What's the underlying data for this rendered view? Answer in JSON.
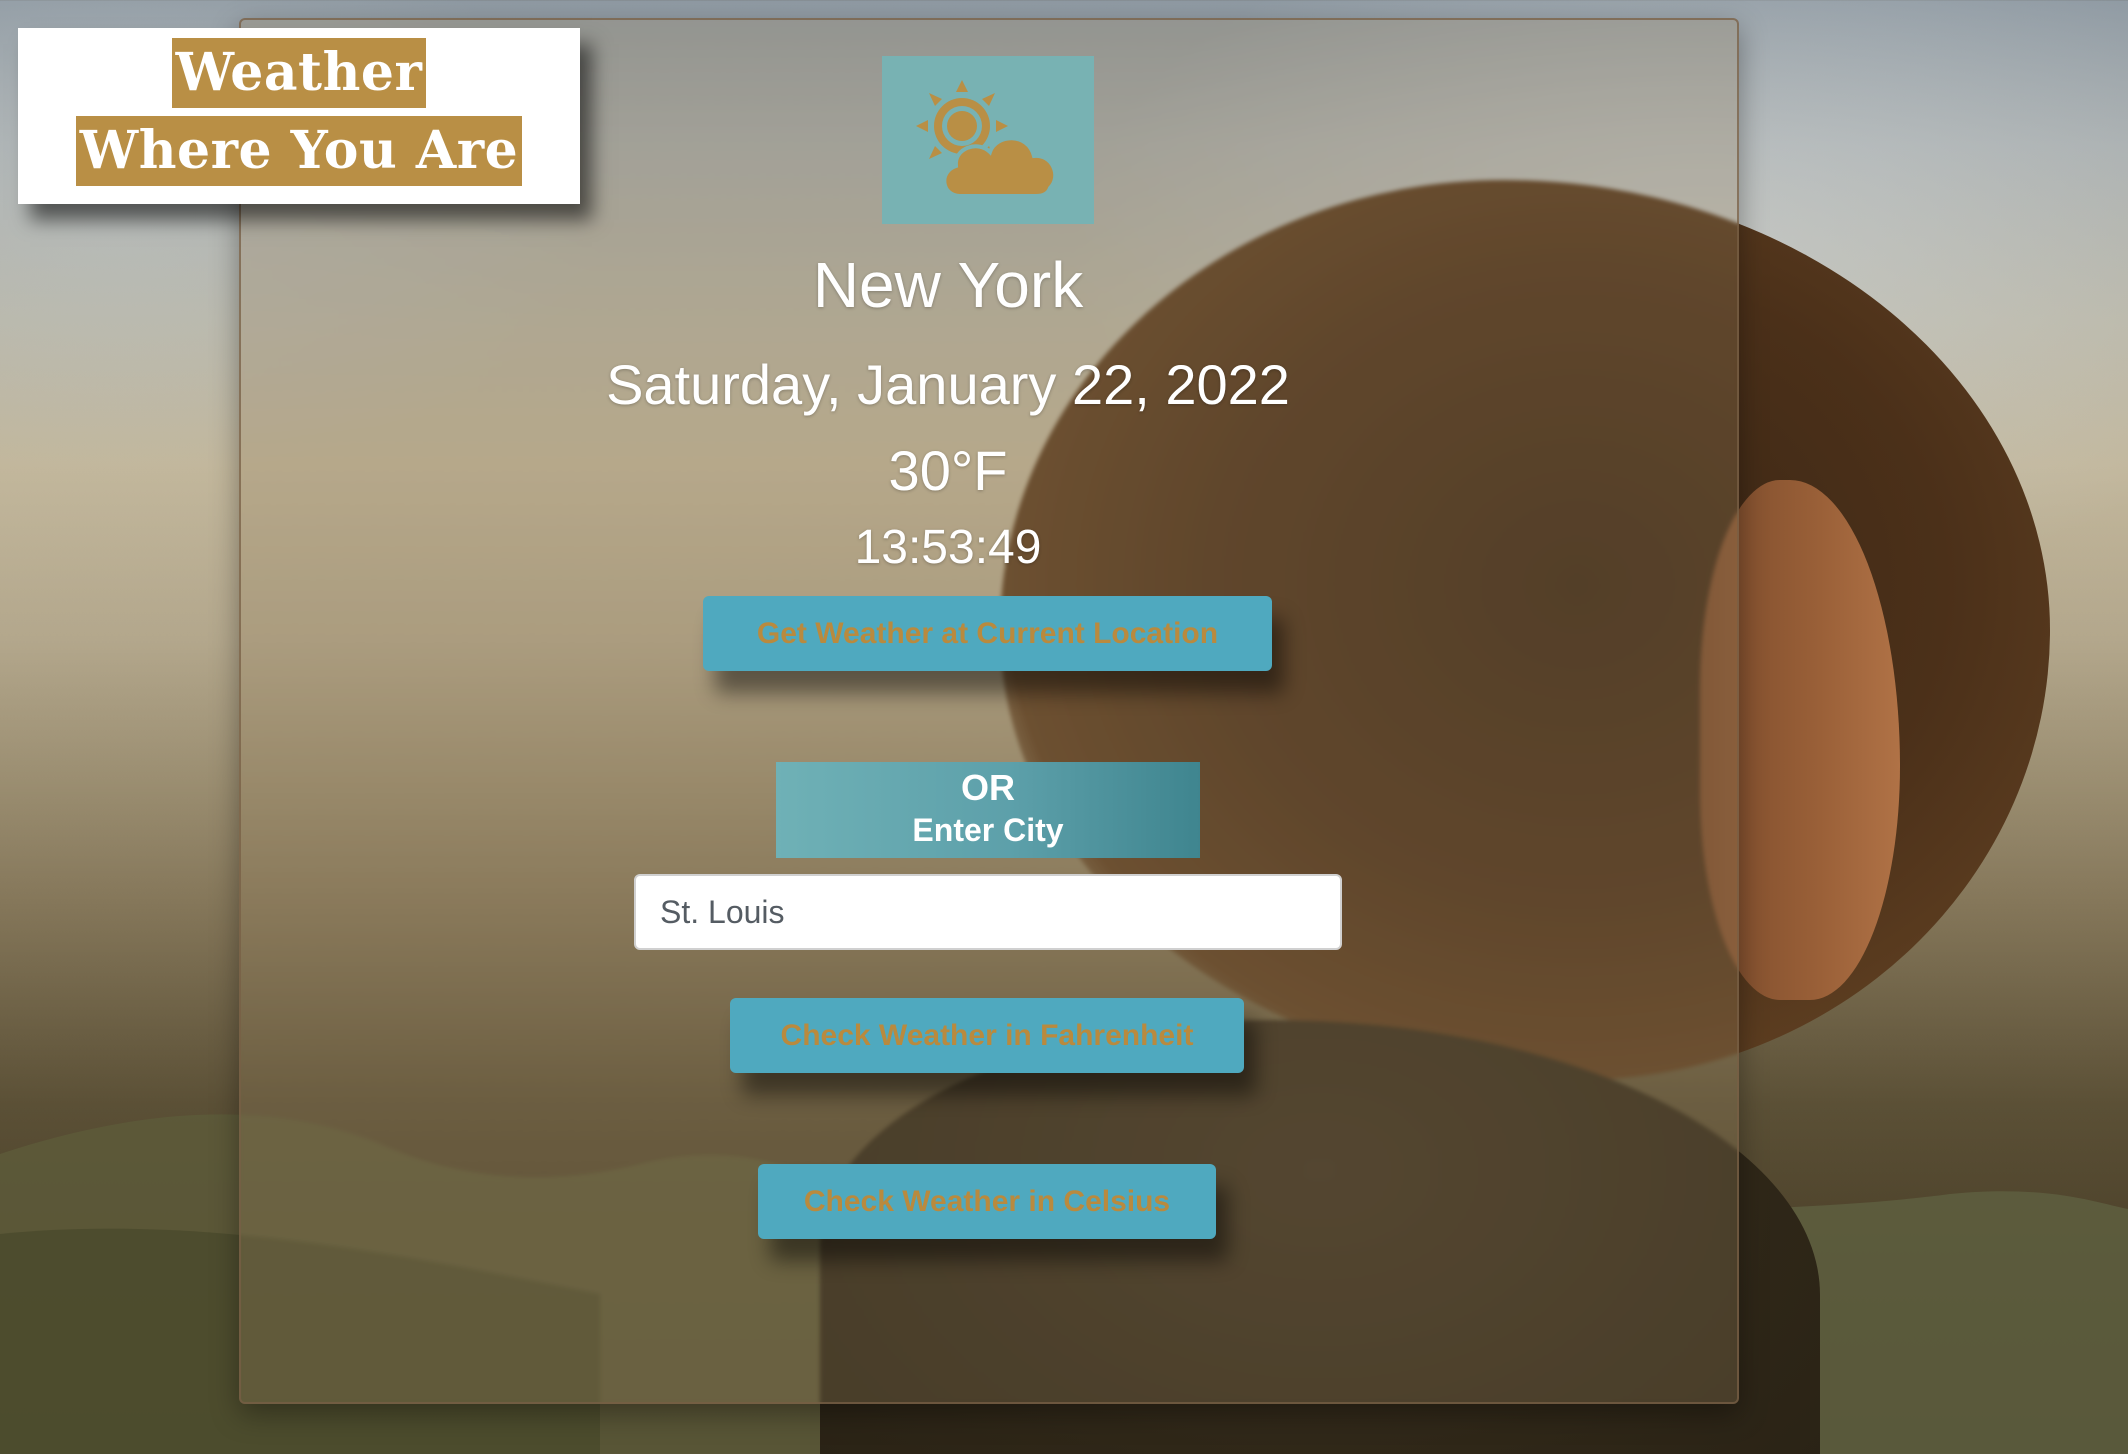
{
  "logo": {
    "line1": "Weather",
    "line2": "Where You Are"
  },
  "weather": {
    "icon": "partly-cloudy-day-icon",
    "city": "New York",
    "date": "Saturday, January 22, 2022",
    "temperature": "30°F",
    "time": "13:53:49"
  },
  "actions": {
    "current_location_label": "Get Weather at Current Location",
    "or_label": "OR",
    "enter_city_label": "Enter City",
    "city_input_value": "St. Louis",
    "fahrenheit_label": "Check Weather in Fahrenheit",
    "celsius_label": "Check Weather in Celsius"
  },
  "colors": {
    "accent_gold": "#b98f45",
    "button_teal": "#4fa9bf",
    "icon_bg": "#78b2b3"
  }
}
